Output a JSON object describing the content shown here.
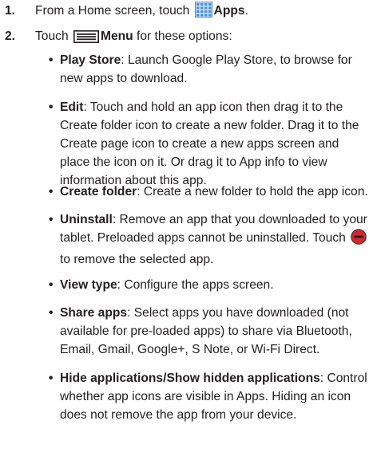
{
  "steps": [
    {
      "number": "1.",
      "pre": "From a Home screen, touch",
      "icon": "apps-grid-icon",
      "label": "Apps",
      "post": "."
    },
    {
      "number": "2.",
      "pre": "Touch",
      "icon": "menu-icon",
      "label": "Menu",
      "post": " for these options:"
    }
  ],
  "options": [
    {
      "term": "Play Store",
      "desc": ": Launch Google Play Store, to browse for new apps to download."
    },
    {
      "term": "Edit",
      "desc": ": Touch and hold an app icon then drag it to the Create folder icon to create a new folder. Drag it to the Create page icon to create a new apps screen and place the icon on it. Or drag it to App info to view information about this app."
    },
    {
      "term": "Create folder",
      "desc": ": Create a new folder to hold the app icon."
    },
    {
      "term": "Uninstall",
      "desc": ": Remove an app that you downloaded to your tablet. Preloaded apps cannot be uninstalled. Touch",
      "icon": "remove-minus-icon",
      "desc_after": " to remove the selected app."
    },
    {
      "term": "View type",
      "desc": ": Configure the apps screen."
    },
    {
      "term": "Share apps",
      "desc": ": Select apps you have downloaded (not available for pre-loaded apps) to share via Bluetooth, Email, Gmail, Google+, S Note, or Wi-Fi Direct."
    },
    {
      "term": "Hide applications/Show hidden applications",
      "desc": ": Control whether app icons are visible in Apps. Hiding an icon does not remove the app from your device."
    }
  ],
  "colors": {
    "text": "#231f20",
    "apps_icon_blue": "#4a8fd6",
    "remove_icon_red": "#d4262b"
  }
}
